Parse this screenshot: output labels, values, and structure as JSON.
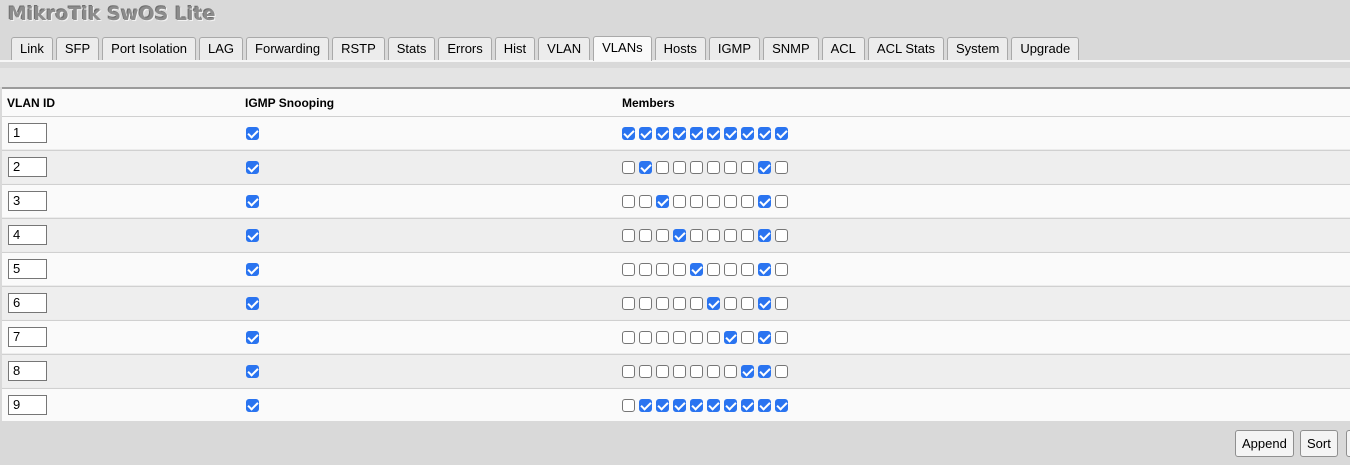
{
  "app_title": "MikroTik SwOS Lite",
  "tabs": [
    "Link",
    "SFP",
    "Port Isolation",
    "LAG",
    "Forwarding",
    "RSTP",
    "Stats",
    "Errors",
    "Hist",
    "VLAN",
    "VLANs",
    "Hosts",
    "IGMP",
    "SNMP",
    "ACL",
    "ACL Stats",
    "System",
    "Upgrade"
  ],
  "active_tab": "VLANs",
  "table": {
    "headers": {
      "vlan_id": "VLAN ID",
      "igmp": "IGMP Snooping",
      "members": "Members"
    },
    "rows": [
      {
        "vlan_id": "1",
        "igmp_snooping": true,
        "members": [
          1,
          1,
          1,
          1,
          1,
          1,
          1,
          1,
          1,
          1
        ]
      },
      {
        "vlan_id": "2",
        "igmp_snooping": true,
        "members": [
          0,
          1,
          0,
          0,
          0,
          0,
          0,
          0,
          1,
          0
        ]
      },
      {
        "vlan_id": "3",
        "igmp_snooping": true,
        "members": [
          0,
          0,
          1,
          0,
          0,
          0,
          0,
          0,
          1,
          0
        ]
      },
      {
        "vlan_id": "4",
        "igmp_snooping": true,
        "members": [
          0,
          0,
          0,
          1,
          0,
          0,
          0,
          0,
          1,
          0
        ]
      },
      {
        "vlan_id": "5",
        "igmp_snooping": true,
        "members": [
          0,
          0,
          0,
          0,
          1,
          0,
          0,
          0,
          1,
          0
        ]
      },
      {
        "vlan_id": "6",
        "igmp_snooping": true,
        "members": [
          0,
          0,
          0,
          0,
          0,
          1,
          0,
          0,
          1,
          0
        ]
      },
      {
        "vlan_id": "7",
        "igmp_snooping": true,
        "members": [
          0,
          0,
          0,
          0,
          0,
          0,
          1,
          0,
          1,
          0
        ]
      },
      {
        "vlan_id": "8",
        "igmp_snooping": true,
        "members": [
          0,
          0,
          0,
          0,
          0,
          0,
          0,
          1,
          1,
          0
        ]
      },
      {
        "vlan_id": "9",
        "igmp_snooping": true,
        "members": [
          0,
          1,
          1,
          1,
          1,
          1,
          1,
          1,
          1,
          1
        ]
      }
    ]
  },
  "buttons": {
    "append": "Append",
    "sort": "Sort"
  },
  "colors": {
    "checkbox_checked": "#2a74f0",
    "title_gray": "#8c8c8c"
  }
}
